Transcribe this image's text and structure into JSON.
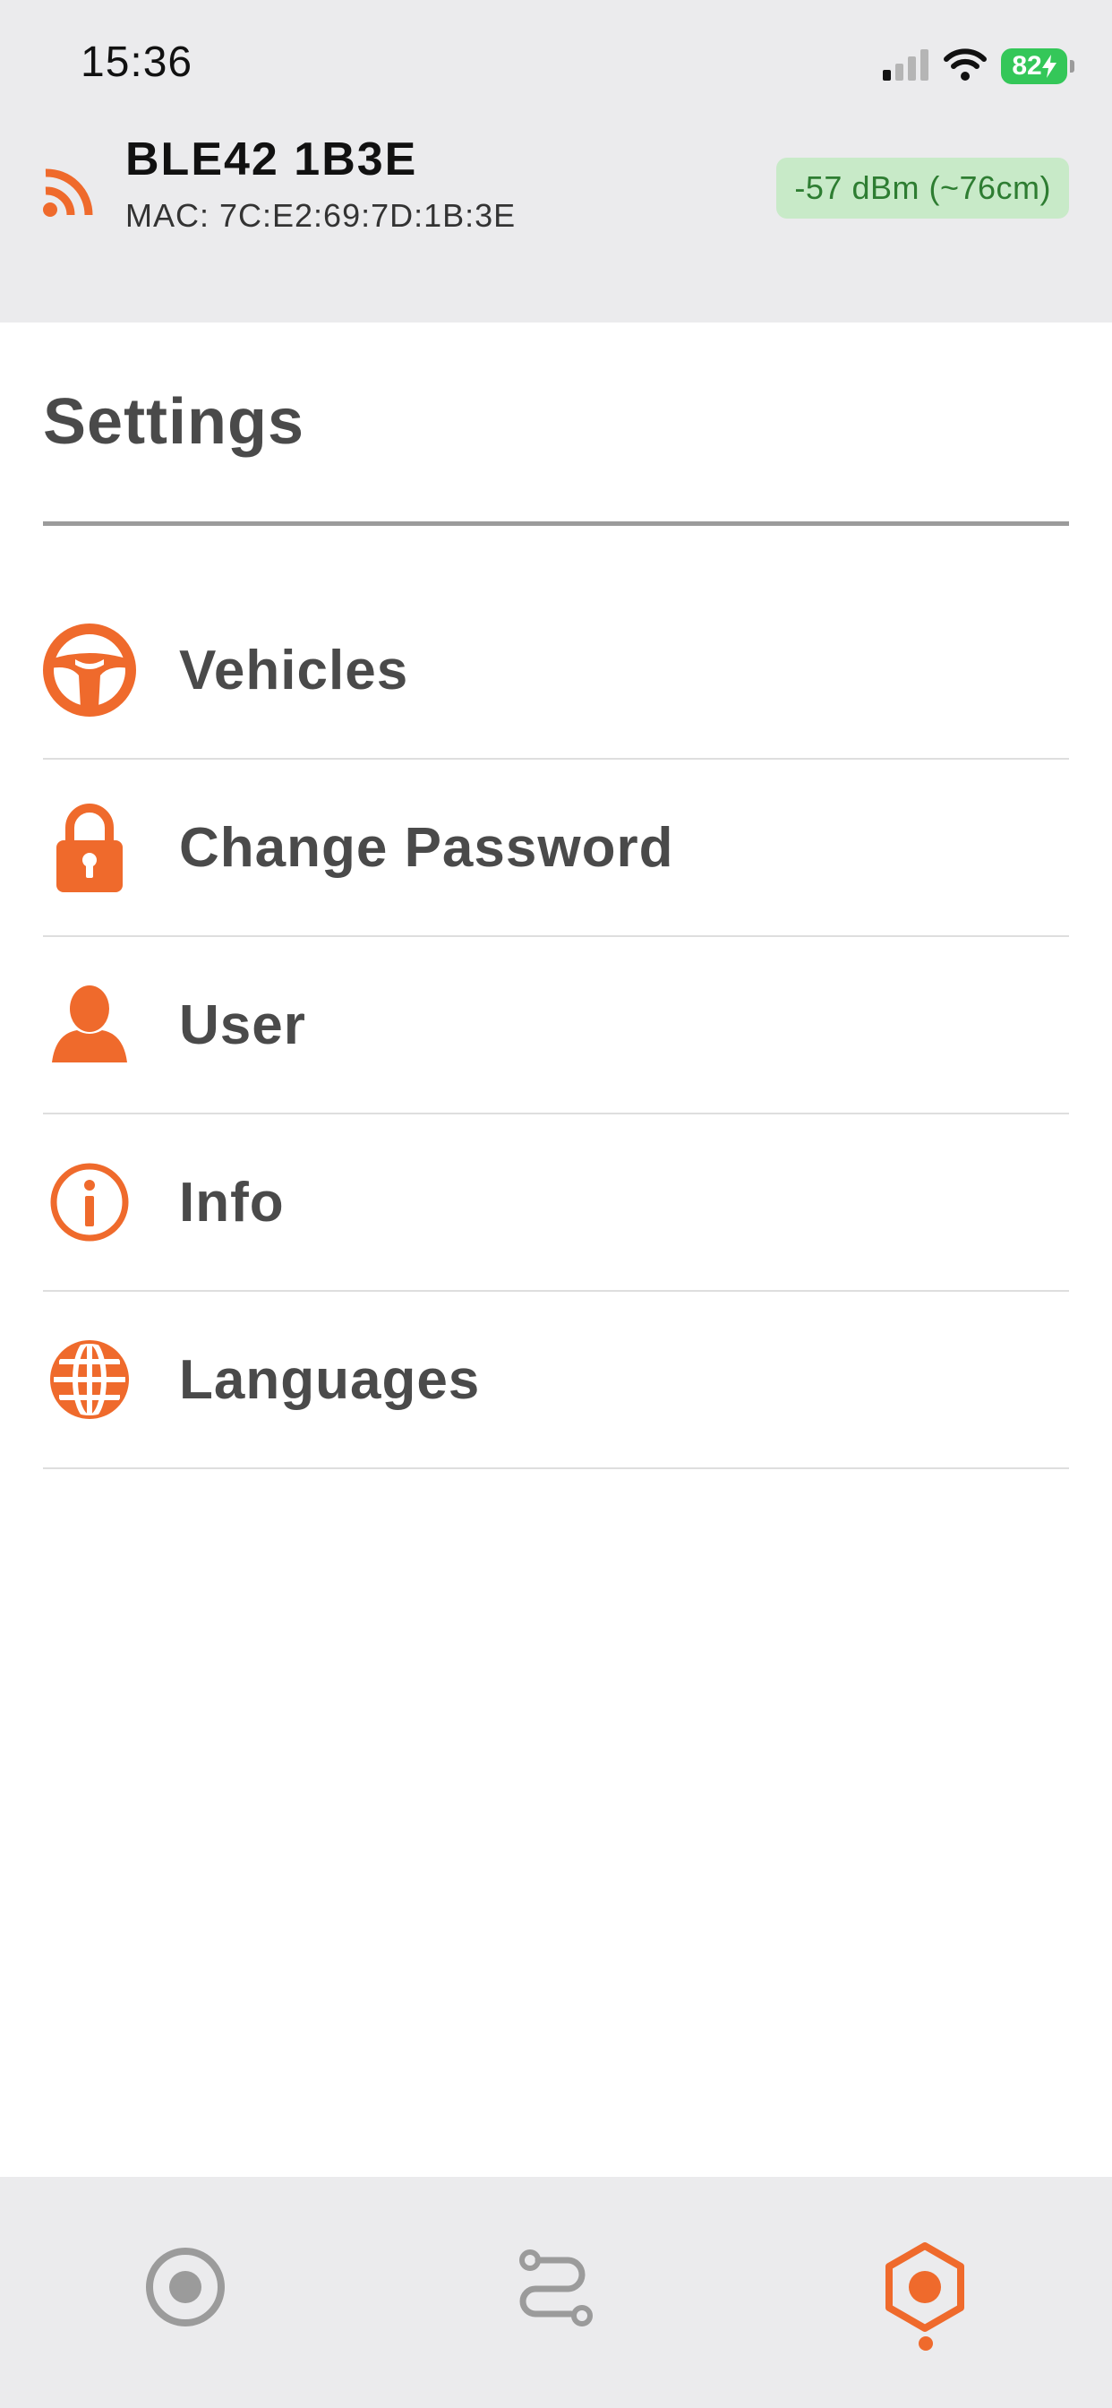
{
  "status_bar": {
    "time": "15:36",
    "battery_level": "82",
    "icons": [
      "cellular-signal-icon",
      "wifi-icon",
      "battery-charging-icon"
    ]
  },
  "device": {
    "name": "BLE42 1B3E",
    "mac": "MAC: 7C:E2:69:7D:1B:3E",
    "rssi": "-57 dBm (~76cm)",
    "icon": "ble-signal-icon"
  },
  "page": {
    "title": "Settings"
  },
  "menu": {
    "items": [
      {
        "label": "Vehicles",
        "icon": "steering-wheel-icon"
      },
      {
        "label": "Change Password",
        "icon": "lock-icon"
      },
      {
        "label": "User",
        "icon": "user-icon"
      },
      {
        "label": "Info",
        "icon": "info-icon"
      },
      {
        "label": "Languages",
        "icon": "globe-icon"
      }
    ]
  },
  "tabs": [
    {
      "icon": "record-icon",
      "active": false
    },
    {
      "icon": "route-icon",
      "active": false
    },
    {
      "icon": "settings-hex-icon",
      "active": true
    }
  ],
  "colors": {
    "accent": "#ef6a2c",
    "header_bg": "#ebebed",
    "badge_bg": "#c8eac8",
    "badge_text": "#2e7d32",
    "battery": "#34c759",
    "text": "#4a4a4a",
    "inactive_icon": "#9b9b9b"
  }
}
